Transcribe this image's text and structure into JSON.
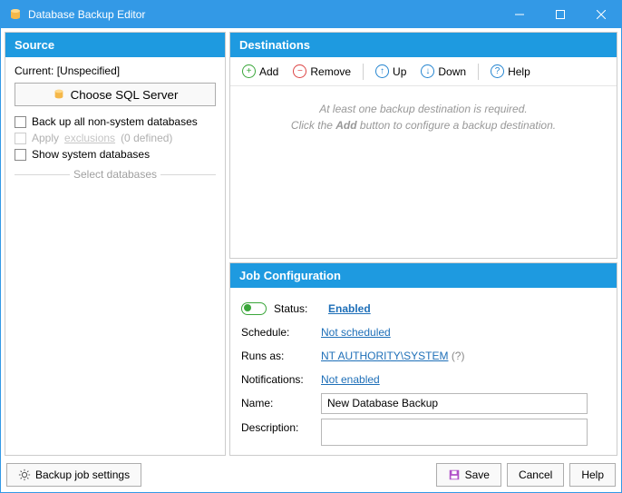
{
  "titlebar": {
    "title": "Database Backup Editor"
  },
  "source": {
    "header": "Source",
    "current_label": "Current:",
    "current_value": "[Unspecified]",
    "choose_button": "Choose SQL Server",
    "chk_backup_all": "Back up all non-system databases",
    "chk_apply_exclusions_a": "Apply",
    "chk_apply_exclusions_link": "exclusions",
    "chk_apply_exclusions_b": "(0 defined)",
    "chk_show_system": "Show system databases",
    "select_db_label": "Select databases"
  },
  "destinations": {
    "header": "Destinations",
    "add": "Add",
    "remove": "Remove",
    "up": "Up",
    "down": "Down",
    "help": "Help",
    "empty_1": "At least one backup destination is required.",
    "empty_2a": "Click the ",
    "empty_2b": "Add",
    "empty_2c": " button to configure a backup destination."
  },
  "job": {
    "header": "Job Configuration",
    "status_label": "Status:",
    "status_value": "Enabled",
    "schedule_label": "Schedule:",
    "schedule_value": "Not scheduled",
    "runsas_label": "Runs as:",
    "runsas_value": "NT AUTHORITY\\SYSTEM",
    "runsas_q": "(?)",
    "notif_label": "Notifications:",
    "notif_value": "Not enabled",
    "name_label": "Name:",
    "name_value": "New Database Backup",
    "desc_label": "Description:",
    "desc_value": ""
  },
  "footer": {
    "settings": "Backup job settings",
    "save": "Save",
    "cancel": "Cancel",
    "help": "Help"
  }
}
